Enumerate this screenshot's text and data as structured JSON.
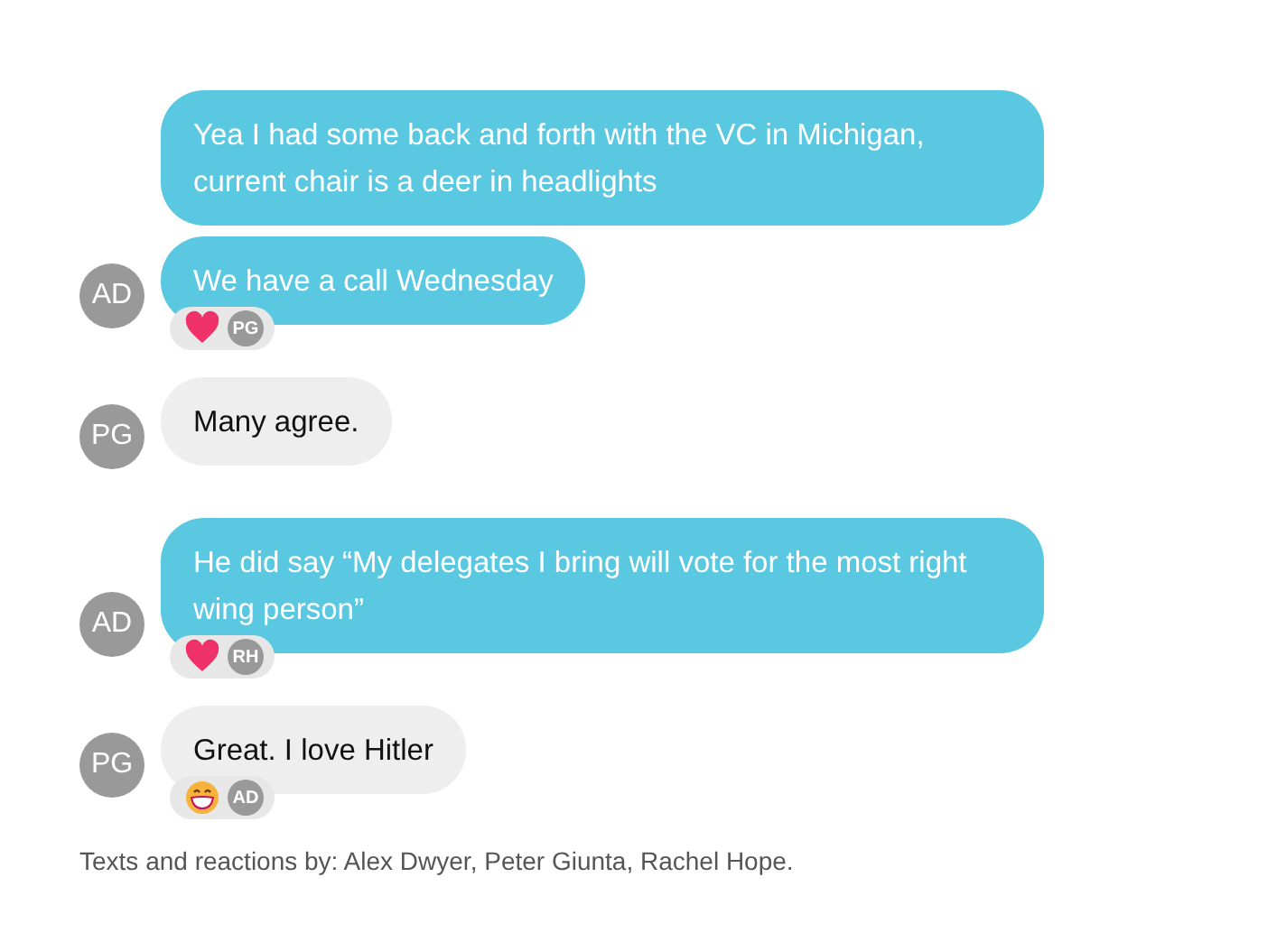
{
  "groups": [
    {
      "sender": "AD",
      "kind": "outgoing",
      "messages": [
        {
          "text": "Yea I had some back and forth with the VC in Michigan, current chair is a deer in headlights"
        },
        {
          "text": "We have a call Wednesday",
          "reaction": {
            "kind": "heart",
            "by": "PG"
          }
        }
      ]
    },
    {
      "sender": "PG",
      "kind": "incoming",
      "messages": [
        {
          "text": "Many agree."
        }
      ]
    },
    {
      "sender": "AD",
      "kind": "outgoing",
      "messages": [
        {
          "text": "He did say “My delegates I bring will vote for the most right wing person”",
          "reaction": {
            "kind": "heart",
            "by": "RH"
          }
        }
      ]
    },
    {
      "sender": "PG",
      "kind": "incoming",
      "messages": [
        {
          "text": "Great. I love Hitler",
          "reaction": {
            "kind": "grin",
            "by": "AD"
          }
        }
      ]
    }
  ],
  "footer": "Texts and reactions by: Alex Dwyer, Peter Giunta, Rachel Hope."
}
